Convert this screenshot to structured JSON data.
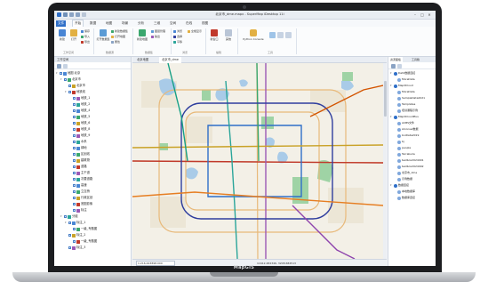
{
  "window": {
    "title": "北京市_dme.mapx - SuperMap iDesktop 11i",
    "minimize": "–",
    "maximize": "□",
    "close": "✕"
  },
  "ribbon": {
    "file_tab": "文件",
    "tabs": [
      "开始",
      "数据",
      "地图",
      "场景",
      "分析",
      "三维",
      "空间",
      "在线",
      "视图"
    ],
    "active_tab": "开始",
    "buttons": {
      "new": "新建",
      "open": "打开",
      "open_dataset": "打开数据集",
      "create_dataset": "新建数据集",
      "open_map": "打开地图",
      "new_map": "新建地图",
      "layer_manager": "图层管理",
      "new_window": "新窗口",
      "python_console": "Python Console",
      "browse": "浏览",
      "select": "选择",
      "pan": "平移",
      "full_extent": "全幅显示",
      "save": "保存",
      "import": "导入",
      "export": "导出",
      "property": "属性",
      "output": "输出",
      "other": "其他"
    },
    "groups": [
      "工作空间",
      "数据源",
      "数据集",
      "地图",
      "浏览",
      "编辑",
      "工具",
      "窗口"
    ]
  },
  "workspace_panel": {
    "title": "工作空间",
    "tree": [
      {
        "label": "地图 北京",
        "level": 1,
        "expanded": true
      },
      {
        "label": "北京市",
        "level": 2,
        "expanded": true
      },
      {
        "label": "北京市",
        "level": 3
      },
      {
        "label": "地铁线",
        "level": 3,
        "expanded": true
      },
      {
        "label": "地铁_1",
        "level": 4
      },
      {
        "label": "地铁_2",
        "level": 4
      },
      {
        "label": "地铁_4",
        "level": 4
      },
      {
        "label": "地铁_5",
        "level": 4
      },
      {
        "label": "地铁_6",
        "level": 4
      },
      {
        "label": "地铁_8",
        "level": 4
      },
      {
        "label": "地铁_9",
        "level": 4
      },
      {
        "label": "水系",
        "level": 4
      },
      {
        "label": "绿地",
        "level": 4
      },
      {
        "label": "区划线",
        "level": 4
      },
      {
        "label": "建筑物",
        "level": 4
      },
      {
        "label": "道路",
        "level": 4
      },
      {
        "label": "主干道",
        "level": 4
      },
      {
        "label": "次要道路",
        "level": 4
      },
      {
        "label": "高速",
        "level": 4
      },
      {
        "label": "立交桥",
        "level": 4
      },
      {
        "label": "行政区划",
        "level": 4
      },
      {
        "label": "底图影像",
        "level": 4
      },
      {
        "label": "标注",
        "level": 4
      },
      {
        "label": "分组",
        "level": 2,
        "expanded": true
      },
      {
        "label": "标注_1",
        "level": 3,
        "expanded": true
      },
      {
        "label": "一级_专题图",
        "level": 4
      },
      {
        "label": "标注_2",
        "level": 3
      },
      {
        "label": "一级_专题图",
        "level": 4
      },
      {
        "label": "标注_3",
        "level": 3
      }
    ]
  },
  "map_window": {
    "tabs": [
      "北京地图",
      "北京市_dme"
    ],
    "active_tab": "北京市_dme",
    "scale": "1:216,443898.000",
    "coordinates": "11612.482346, 3208.684513"
  },
  "resource_panel": {
    "tabs": [
      "资源面板",
      "工具箱"
    ],
    "active_tab": "资源面板",
    "items": [
      {
        "label": "Dat2数据连接",
        "level": 1,
        "expanded": true
      },
      {
        "label": "MoreData",
        "level": 2
      },
      {
        "label": "MapXCloud",
        "level": 1,
        "expanded": true
      },
      {
        "label": "MoreData",
        "level": 2
      },
      {
        "label": "SampleData2021",
        "level": 2
      },
      {
        "label": "Templates",
        "level": 2
      },
      {
        "label": "培训课程示例",
        "level": 2
      },
      {
        "label": "MapXCloudPlus",
        "level": 1,
        "expanded": true
      },
      {
        "label": "ACBS文件",
        "level": 2
      },
      {
        "label": "Alconsel数据",
        "level": 2
      },
      {
        "label": "boiData2019",
        "level": 2
      },
      {
        "label": "bj",
        "level": 2
      },
      {
        "label": "people",
        "level": 2
      },
      {
        "label": "Terrabuila",
        "level": 2
      },
      {
        "label": "testbox2024091",
        "level": 2
      },
      {
        "label": "testbox2024092",
        "level": 2
      },
      {
        "label": "北京市_dme",
        "level": 2
      },
      {
        "label": "示例数据",
        "level": 2
      },
      {
        "label": "数据连接",
        "level": 1,
        "expanded": true
      },
      {
        "label": "本地数据库",
        "level": 2
      },
      {
        "label": "数据库连接",
        "level": 2
      }
    ]
  },
  "brand": "MapGIS",
  "colors": {
    "ribbon_bg": "#fbfcfd",
    "panel_header": "#e6ebf2",
    "accent": "#2f6fc8",
    "map_bg": "#f3f0e7",
    "water": "#a9cbe8",
    "green": "#9fd3a5",
    "line1": "#c0392b",
    "line2": "#2f6fc8",
    "line4": "#2aa59a",
    "line5": "#9b59b6",
    "line6": "#c9a227",
    "line8": "#3aa76d",
    "line10": "#2f3e9e",
    "road": "#e8b97a"
  }
}
